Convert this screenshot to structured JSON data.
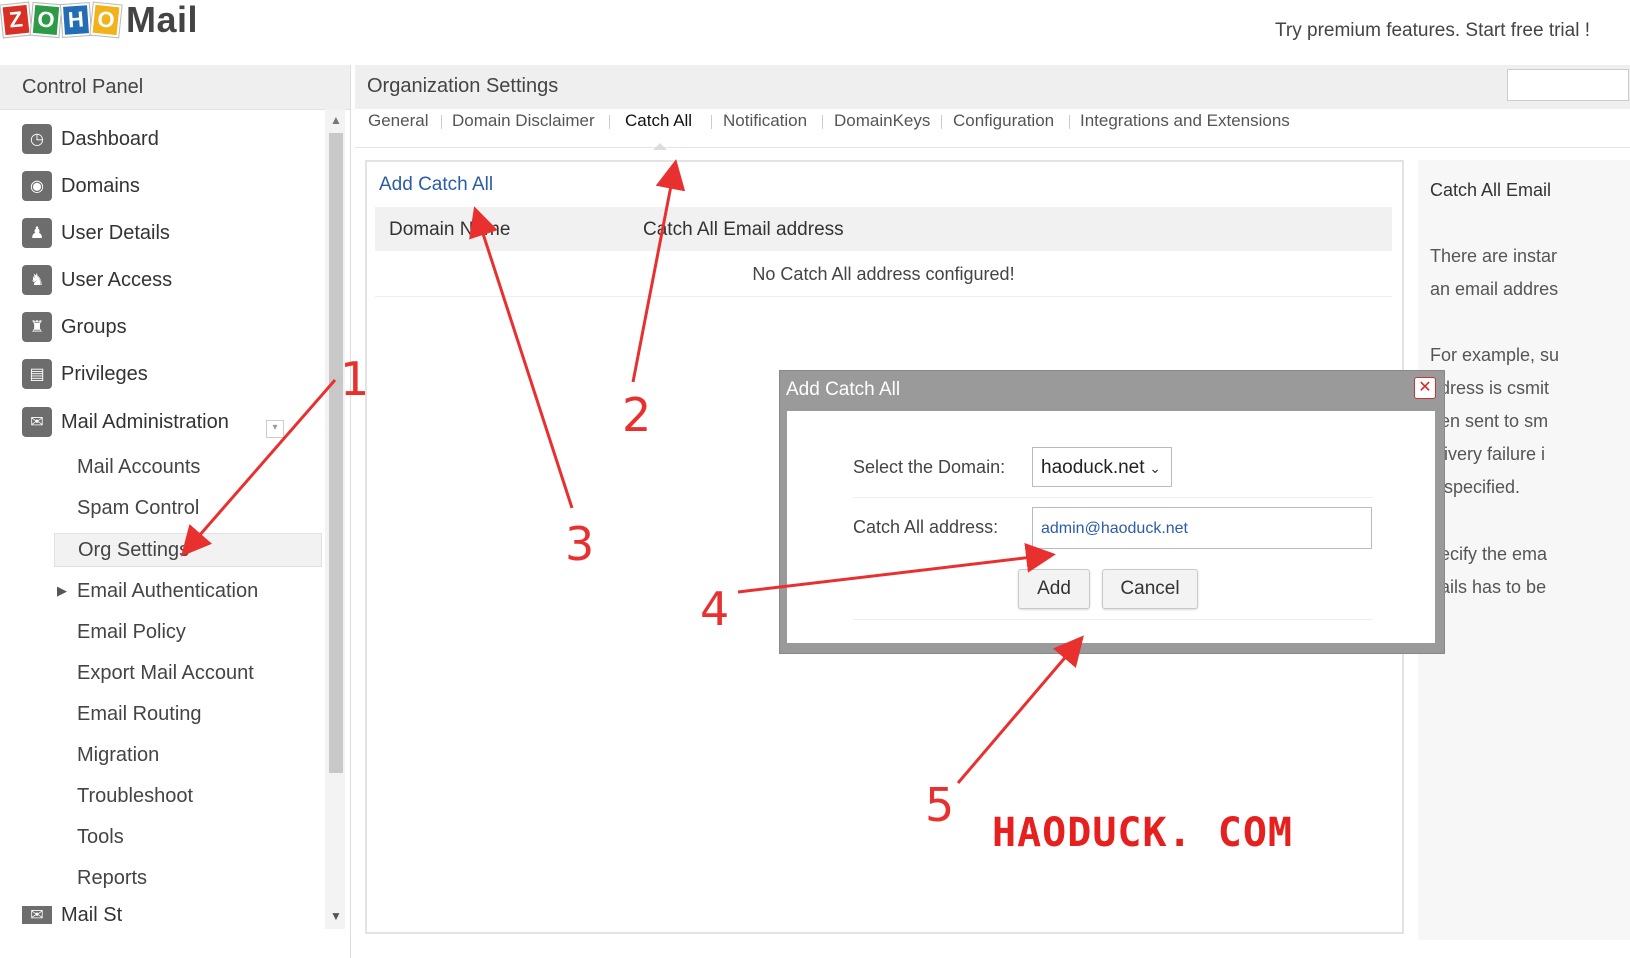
{
  "header": {
    "logo_letters": [
      "Z",
      "O",
      "H",
      "O"
    ],
    "logo_colors": [
      "#d93025",
      "#2d9b46",
      "#226db4",
      "#f2b21b"
    ],
    "logo_word": "Mail",
    "promo": "Try premium features. Start free trial !"
  },
  "control_panel": {
    "title": "Control Panel",
    "items": [
      {
        "label": "Dashboard",
        "icon": "dashboard-icon"
      },
      {
        "label": "Domains",
        "icon": "globe-icon"
      },
      {
        "label": "User Details",
        "icon": "user-icon"
      },
      {
        "label": "User Access",
        "icon": "user-access-icon"
      },
      {
        "label": "Groups",
        "icon": "group-icon"
      },
      {
        "label": "Privileges",
        "icon": "document-icon"
      },
      {
        "label": "Mail Administration",
        "icon": "envelope-icon"
      }
    ],
    "sub_items": [
      "Mail Accounts",
      "Spam Control",
      "Org Settings",
      "Email Authentication",
      "Email Policy",
      "Export Mail Account",
      "Email Routing",
      "Migration",
      "Troubleshoot",
      "Tools",
      "Reports"
    ],
    "active_sub_item": "Org Settings",
    "truncated_next_item": "Mail St"
  },
  "main": {
    "title": "Organization Settings",
    "tabs": [
      "General",
      "Domain Disclaimer",
      "Catch All",
      "Notification",
      "DomainKeys",
      "Configuration",
      "Integrations and Extensions"
    ],
    "active_tab": "Catch All",
    "add_link": "Add Catch All",
    "table": {
      "columns": [
        "Domain Name",
        "Catch All Email address"
      ],
      "empty_message": "No Catch All address configured!"
    }
  },
  "right_panel": {
    "title": "Catch All Email",
    "lines": [
      "There are instar",
      "an email addres",
      "For example, su",
      "ddress is csmit",
      "een sent to sm",
      "elivery failure i",
      "s specified.",
      "pecify the ema",
      "nails has to be"
    ]
  },
  "modal": {
    "title": "Add Catch All",
    "domain_label": "Select the Domain:",
    "domain_value": "haoduck.net",
    "address_label": "Catch All address:",
    "address_value": "admin@haoduck.net",
    "add_button": "Add",
    "cancel_button": "Cancel"
  },
  "annotations": {
    "steps": [
      "1",
      "2",
      "3",
      "4",
      "5"
    ],
    "color": "#e8302f"
  },
  "watermark": "HAODUCK. COM"
}
